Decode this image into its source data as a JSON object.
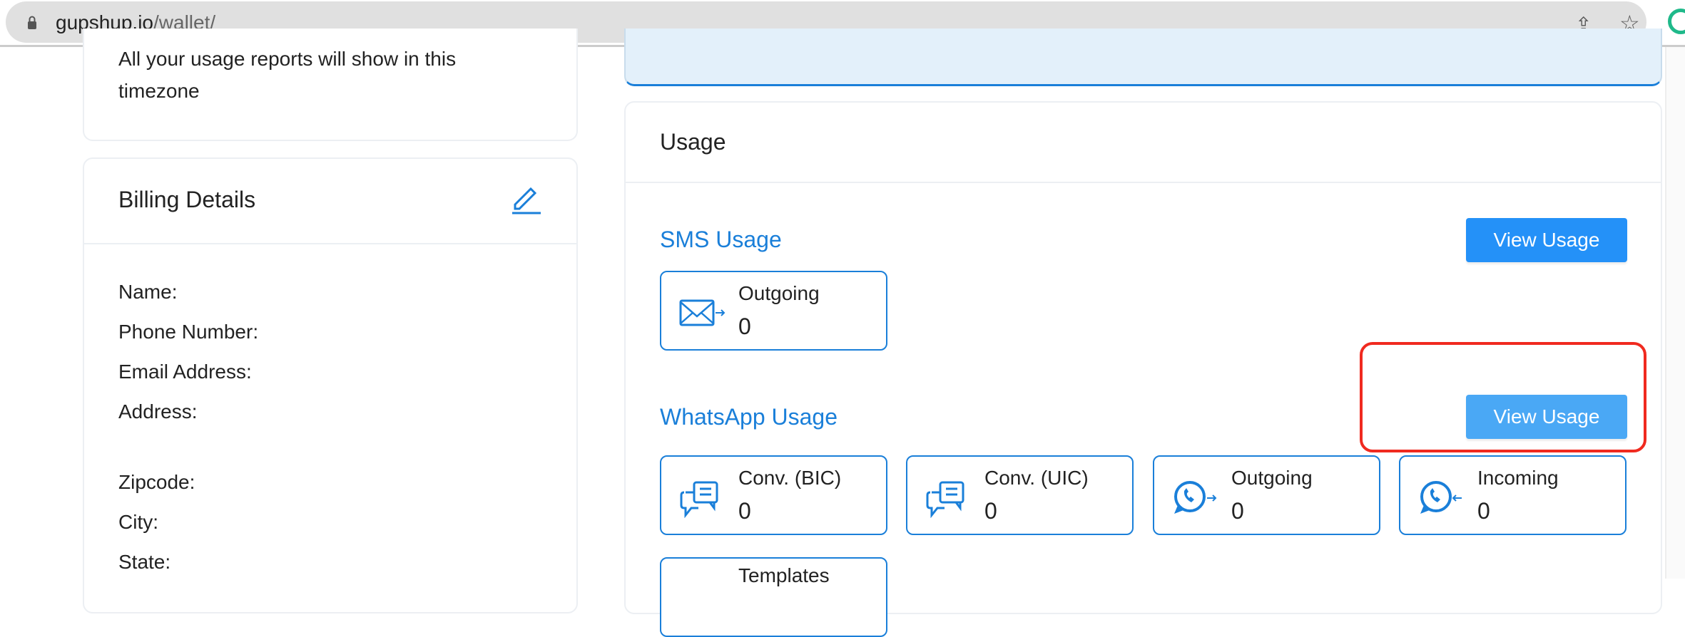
{
  "browser": {
    "url_domain": "gupshup.io",
    "url_path": "/wallet/"
  },
  "timezone_card": {
    "note_line1": "All your usage reports will show in this",
    "note_line2": "timezone"
  },
  "billing": {
    "title": "Billing Details",
    "fields": [
      "Name:",
      "Phone Number:",
      "Email Address:",
      "Address:",
      "Zipcode:",
      "City:",
      "State:"
    ]
  },
  "usage": {
    "title": "Usage",
    "sms": {
      "title": "SMS Usage",
      "button": "View Usage",
      "cards": [
        {
          "label": "Outgoing",
          "value": "0",
          "icon": "envelope-outgoing-icon"
        }
      ]
    },
    "whatsapp": {
      "title": "WhatsApp Usage",
      "button": "View Usage",
      "cards": [
        {
          "label": "Conv. (BIC)",
          "value": "0",
          "icon": "chat-bubbles-icon"
        },
        {
          "label": "Conv. (UIC)",
          "value": "0",
          "icon": "chat-bubbles-icon"
        },
        {
          "label": "Outgoing",
          "value": "0",
          "icon": "whatsapp-outgoing-icon"
        },
        {
          "label": "Incoming",
          "value": "0",
          "icon": "whatsapp-incoming-icon"
        },
        {
          "label": "Templates",
          "value": "",
          "icon": "template-icon"
        }
      ]
    }
  },
  "colors": {
    "accent": "#1a7fd9",
    "button": "#2491f8",
    "button_hover": "#4aa8f5",
    "highlight": "#f02a1f",
    "info_bg": "#e3f0fa"
  }
}
